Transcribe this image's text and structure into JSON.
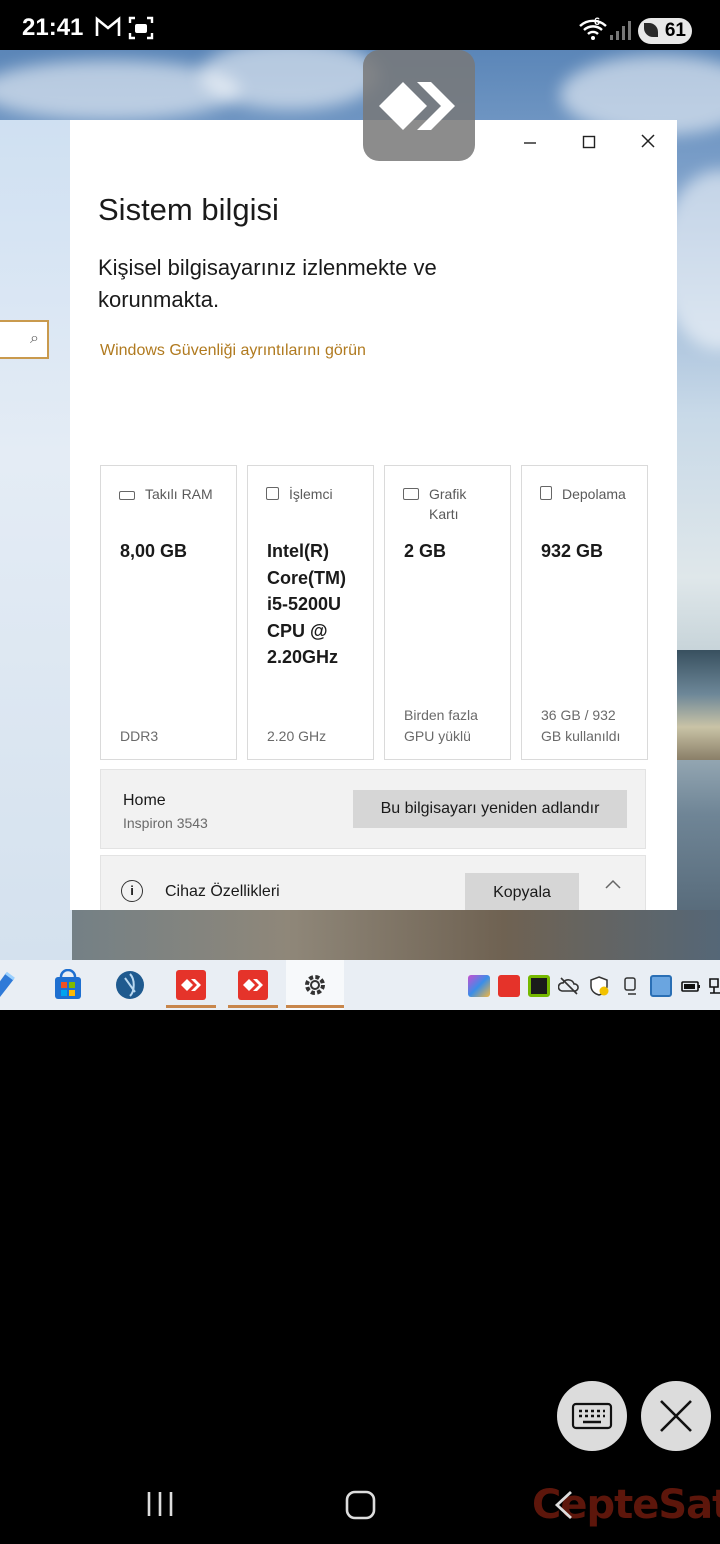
{
  "status_bar": {
    "time": "21:41",
    "battery": "61",
    "signal_badge": "6"
  },
  "window": {
    "title": "Sistem bilgisi",
    "subtitle": "Kişisel bilgisayarınız izlenmekte ve korunmakta.",
    "security_link": "Windows Güvenliği ayrıntılarını görün",
    "cards": [
      {
        "label": "Takılı RAM",
        "value": "8,00 GB",
        "footer": "DDR3"
      },
      {
        "label": "İşlemci",
        "value": "Intel(R) Core(TM) i5-5200U CPU @ 2.20GHz",
        "footer": "2.20 GHz"
      },
      {
        "label": "Grafik Kartı",
        "value": "2 GB",
        "footer": "Birden fazla GPU yüklü"
      },
      {
        "label": "Depolama",
        "value": "932 GB",
        "footer": "36 GB / 932 GB kullanıldı"
      }
    ],
    "device": {
      "name": "Home",
      "model": "Inspiron 3543",
      "rename_button": "Bu bilgisayarı yeniden adlandır"
    },
    "specs": {
      "label": "Cihaz Özellikleri",
      "copy_button": "Kopyala"
    }
  },
  "watermark": "CepteSat",
  "colors": {
    "accent_link": "#b07a1f",
    "anydesk_red": "#e5332a",
    "taskbar": "#e9eef4"
  }
}
